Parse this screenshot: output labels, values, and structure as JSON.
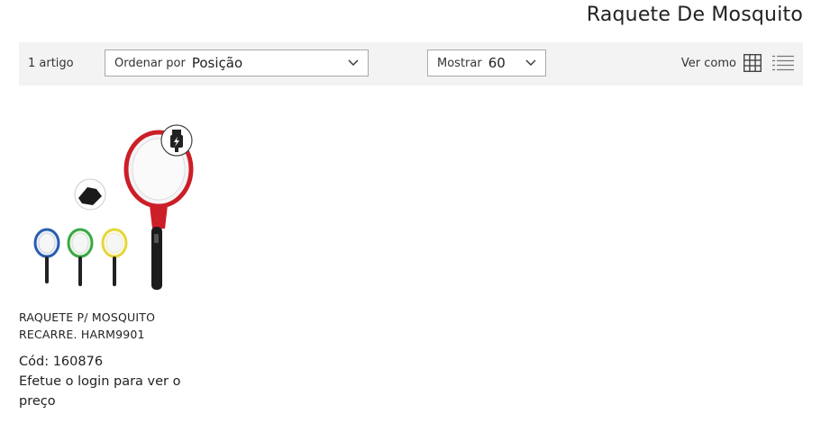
{
  "page": {
    "title": "Raquete De Mosquito"
  },
  "toolbar": {
    "count": "1 artigo",
    "sort_label": "Ordenar por",
    "sort_value": "Posição",
    "show_label": "Mostrar",
    "show_value": "60",
    "view_label": "Ver como",
    "view_icons": [
      "grid-icon",
      "list-icon"
    ]
  },
  "products": [
    {
      "name": "RAQUETE P/ MOSQUITO RECARRE. HARM9901",
      "code": "Cód: 160876",
      "price_note": "Efetue o login para ver o preço"
    }
  ]
}
